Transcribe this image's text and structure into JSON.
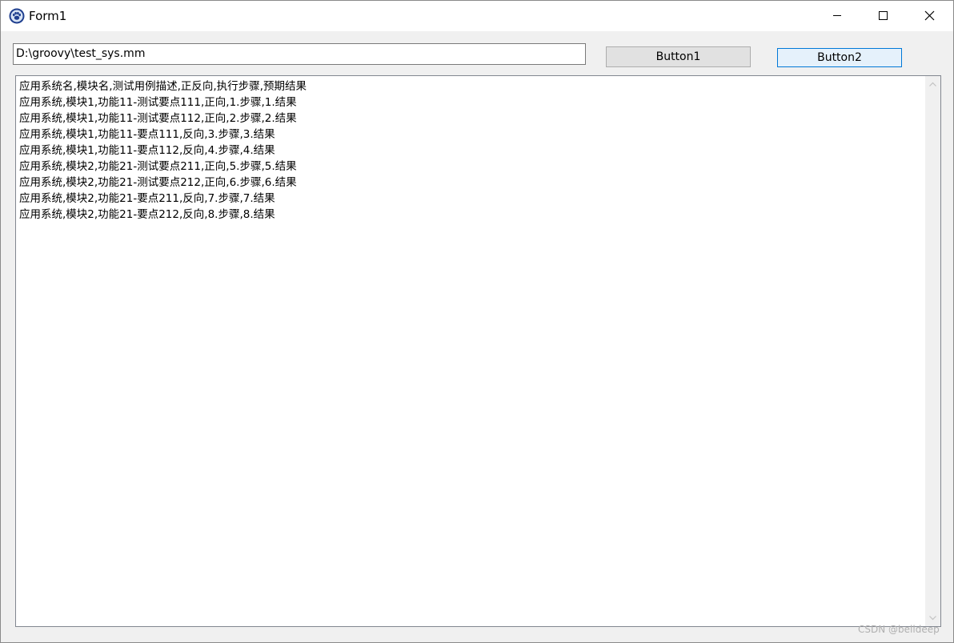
{
  "window": {
    "title": "Form1",
    "app_icon": "paw-icon"
  },
  "controls": {
    "minimize_icon": "minimize-icon",
    "maximize_icon": "maximize-icon",
    "close_icon": "close-icon"
  },
  "path_input": {
    "value": "D:\\groovy\\test_sys.mm"
  },
  "buttons": {
    "button1_label": "Button1",
    "button2_label": "Button2"
  },
  "memo": {
    "lines": [
      "应用系统名,模块名,测试用例描述,正反向,执行步骤,预期结果",
      "应用系统,模块1,功能11-测试要点111,正向,1.步骤,1.结果",
      "应用系统,模块1,功能11-测试要点112,正向,2.步骤,2.结果",
      "应用系统,模块1,功能11-要点111,反向,3.步骤,3.结果",
      "应用系统,模块1,功能11-要点112,反向,4.步骤,4.结果",
      "应用系统,模块2,功能21-测试要点211,正向,5.步骤,5.结果",
      "应用系统,模块2,功能21-测试要点212,正向,6.步骤,6.结果",
      "应用系统,模块2,功能21-要点211,反向,7.步骤,7.结果",
      "应用系统,模块2,功能21-要点212,反向,8.步骤,8.结果"
    ]
  },
  "watermark": "CSDN @belldeep",
  "colors": {
    "button2_border": "#0078d7",
    "button2_background": "#e5f1fb",
    "window_background": "#f0f0f0"
  }
}
